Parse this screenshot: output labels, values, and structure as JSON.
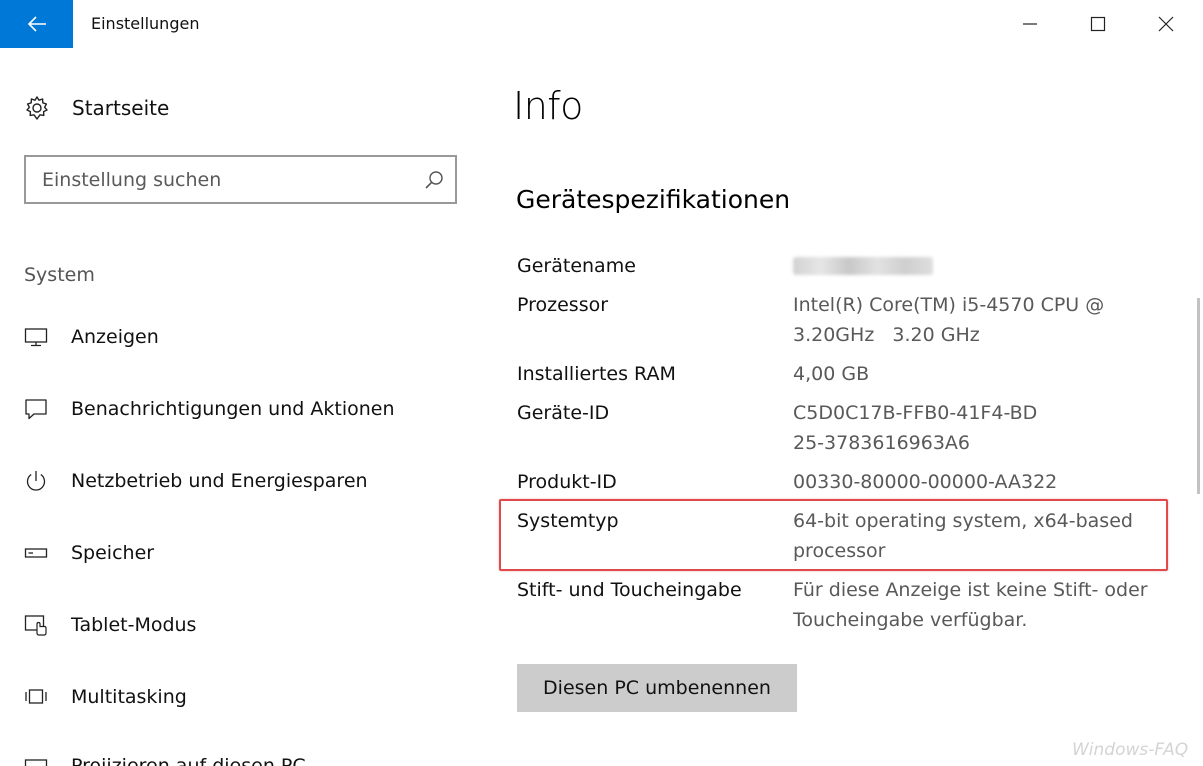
{
  "window": {
    "title": "Einstellungen",
    "back_icon": "arrow-left-icon",
    "accent_color": "#0078d7"
  },
  "sidebar": {
    "home_label": "Startseite",
    "search_placeholder": "Einstellung suchen",
    "section_label": "System",
    "items": [
      {
        "label": "Anzeigen",
        "icon": "monitor-icon"
      },
      {
        "label": "Benachrichtigungen und Aktionen",
        "icon": "notification-icon"
      },
      {
        "label": "Netzbetrieb und Energiesparen",
        "icon": "power-icon"
      },
      {
        "label": "Speicher",
        "icon": "storage-icon"
      },
      {
        "label": "Tablet-Modus",
        "icon": "tablet-mode-icon"
      },
      {
        "label": "Multitasking",
        "icon": "multitasking-icon"
      },
      {
        "label": "Projizieren auf diesen PC",
        "icon": "project-icon"
      }
    ]
  },
  "main": {
    "title": "Info",
    "section_title": "Gerätespezifikationen",
    "specs": [
      {
        "key": "Gerätename",
        "value": ""
      },
      {
        "key": "Prozessor",
        "value": "Intel(R) Core(TM) i5-4570 CPU @ 3.20GHz   3.20 GHz"
      },
      {
        "key": "Installiertes RAM",
        "value": "4,00 GB"
      },
      {
        "key": "Geräte-ID",
        "value": "C5D0C17B-FFB0-41F4-BD25-3783616963A6"
      },
      {
        "key": "Produkt-ID",
        "value": "00330-80000-00000-AA322"
      },
      {
        "key": "Systemtyp",
        "value": "64-bit operating system, x64-based processor"
      },
      {
        "key": "Stift- und Toucheingabe",
        "value": "Für diese Anzeige ist keine Stift- oder Toucheingabe verfügbar."
      }
    ],
    "rename_button": "Diesen PC umbenennen",
    "highlight_color": "#e04a4a"
  },
  "watermark": "Windows-FAQ"
}
